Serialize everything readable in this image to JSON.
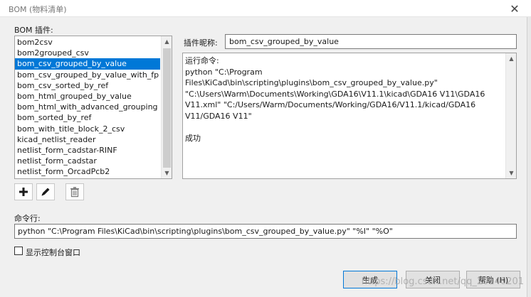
{
  "window": {
    "title": "BOM (物料清单)",
    "close_glyph": "✕"
  },
  "plugins_panel": {
    "label": "BOM 插件:",
    "items": [
      "bom2csv",
      "bom2grouped_csv",
      "bom_csv_grouped_by_value",
      "bom_csv_grouped_by_value_with_fp",
      "bom_csv_sorted_by_ref",
      "bom_html_grouped_by_value",
      "bom_html_with_advanced_grouping",
      "bom_sorted_by_ref",
      "bom_with_title_block_2_csv",
      "kicad_netlist_reader",
      "netlist_form_cadstar-RINF",
      "netlist_form_cadstar",
      "netlist_form_OrcadPcb2"
    ],
    "selected_index": 2
  },
  "nickname": {
    "label": "插件昵称:",
    "value": "bom_csv_grouped_by_value"
  },
  "output": {
    "text": "运行命令:\npython \"C:\\Program Files\\KiCad\\bin\\scripting\\plugins\\bom_csv_grouped_by_value.py\"\n\"C:\\Users\\Warm\\Documents\\Working\\GDA16\\V11.1\\kicad\\GDA16 V11\\GDA16\nV11.xml\" \"C:/Users/Warm/Documents/Working/GDA16/V11.1/kicad/GDA16\nV11/GDA16 V11\"\n\n成功"
  },
  "command_line": {
    "label": "命令行:",
    "value": "python \"C:\\Program Files\\KiCad\\bin\\scripting\\plugins\\bom_csv_grouped_by_value.py\" \"%I\" \"%O\""
  },
  "console_checkbox": {
    "label": "显示控制台窗口",
    "checked": false
  },
  "buttons": {
    "generate": "生成",
    "close": "关闭",
    "help": "帮助 (H)"
  },
  "watermark": "https://blog.csdn.net/qq_20140201",
  "icons": {
    "add": "plus-icon",
    "edit": "pencil-icon",
    "delete": "trash-icon"
  },
  "colors": {
    "selection": "#0078d7",
    "window_bg": "#f0f0f0"
  }
}
